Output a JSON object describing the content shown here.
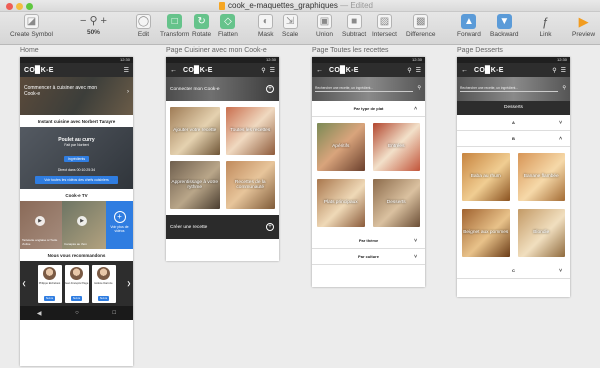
{
  "window": {
    "title": "cook_e-maquettes_graphiques",
    "edited": "— Edited"
  },
  "toolbar": {
    "create_symbol": "Create Symbol",
    "zoom_value": "50%",
    "edit": "Edit",
    "transform": "Transform",
    "rotate": "Rotate",
    "flatten": "Flatten",
    "mask": "Mask",
    "scale": "Scale",
    "union": "Union",
    "subtract": "Subtract",
    "intersect": "Intersect",
    "difference": "Difference",
    "forward": "Forward",
    "backward": "Backward",
    "link": "Link",
    "preview": "Preview"
  },
  "artboards": {
    "home": "Home",
    "cuisiner": "Page Cuisiner avec mon Cook-e",
    "recettes": "Page Toutes les recettes",
    "desserts": "Page Desserts"
  },
  "status": {
    "time": "12:30"
  },
  "logo": "CO▉K-E",
  "home": {
    "hero": "Commencer à cuisiner avec mon Cook-e",
    "instant": "Instant cuisine avec Norbert Tarayre",
    "live_title": "Poulet au curry",
    "live_sub": "Fait par Norbert",
    "live_btn": "Ingrédients",
    "live_time": "Direct dans 00:10:25:34",
    "live_all": "Voir toutes les vidéos des chefs cuisiniers",
    "tv_title": "Cook-e TV",
    "video1": "Tartelette anglaise à l'huile d'olive",
    "video2": "Canapés au thon",
    "more_videos": "Voir plus de vidéos",
    "reco_title": "Nous vous recommandons",
    "chefs": [
      {
        "name": "Philippe Etchebest"
      },
      {
        "name": "Jean François Piège"
      },
      {
        "name": "Hélène Darroze"
      }
    ],
    "follow": "Suivre"
  },
  "cuisiner": {
    "connect": "Connecter mon Cook-e",
    "tiles": [
      "Ajouter votre recette",
      "Toutes les recettes",
      "Apprentissage à votre rythme",
      "Recettes de la communauté"
    ],
    "create": "Créer une recette"
  },
  "recettes": {
    "search_placeholder": "Rechercher une recette, un ingrédient...",
    "by_type": "Par type de plat",
    "tiles": [
      "Apéritifs",
      "Entrées",
      "Plats principaux",
      "Desserts"
    ],
    "by_theme": "Par thème",
    "by_culture": "Par culture"
  },
  "desserts": {
    "search_placeholder": "Rechercher une recette, un ingrédient...",
    "title": "Desserts",
    "a": "A",
    "b": "B",
    "c": "C",
    "tiles": [
      "Baba au rhum",
      "Banane flambée",
      "Beignet aux pommes",
      "Blondie"
    ]
  }
}
